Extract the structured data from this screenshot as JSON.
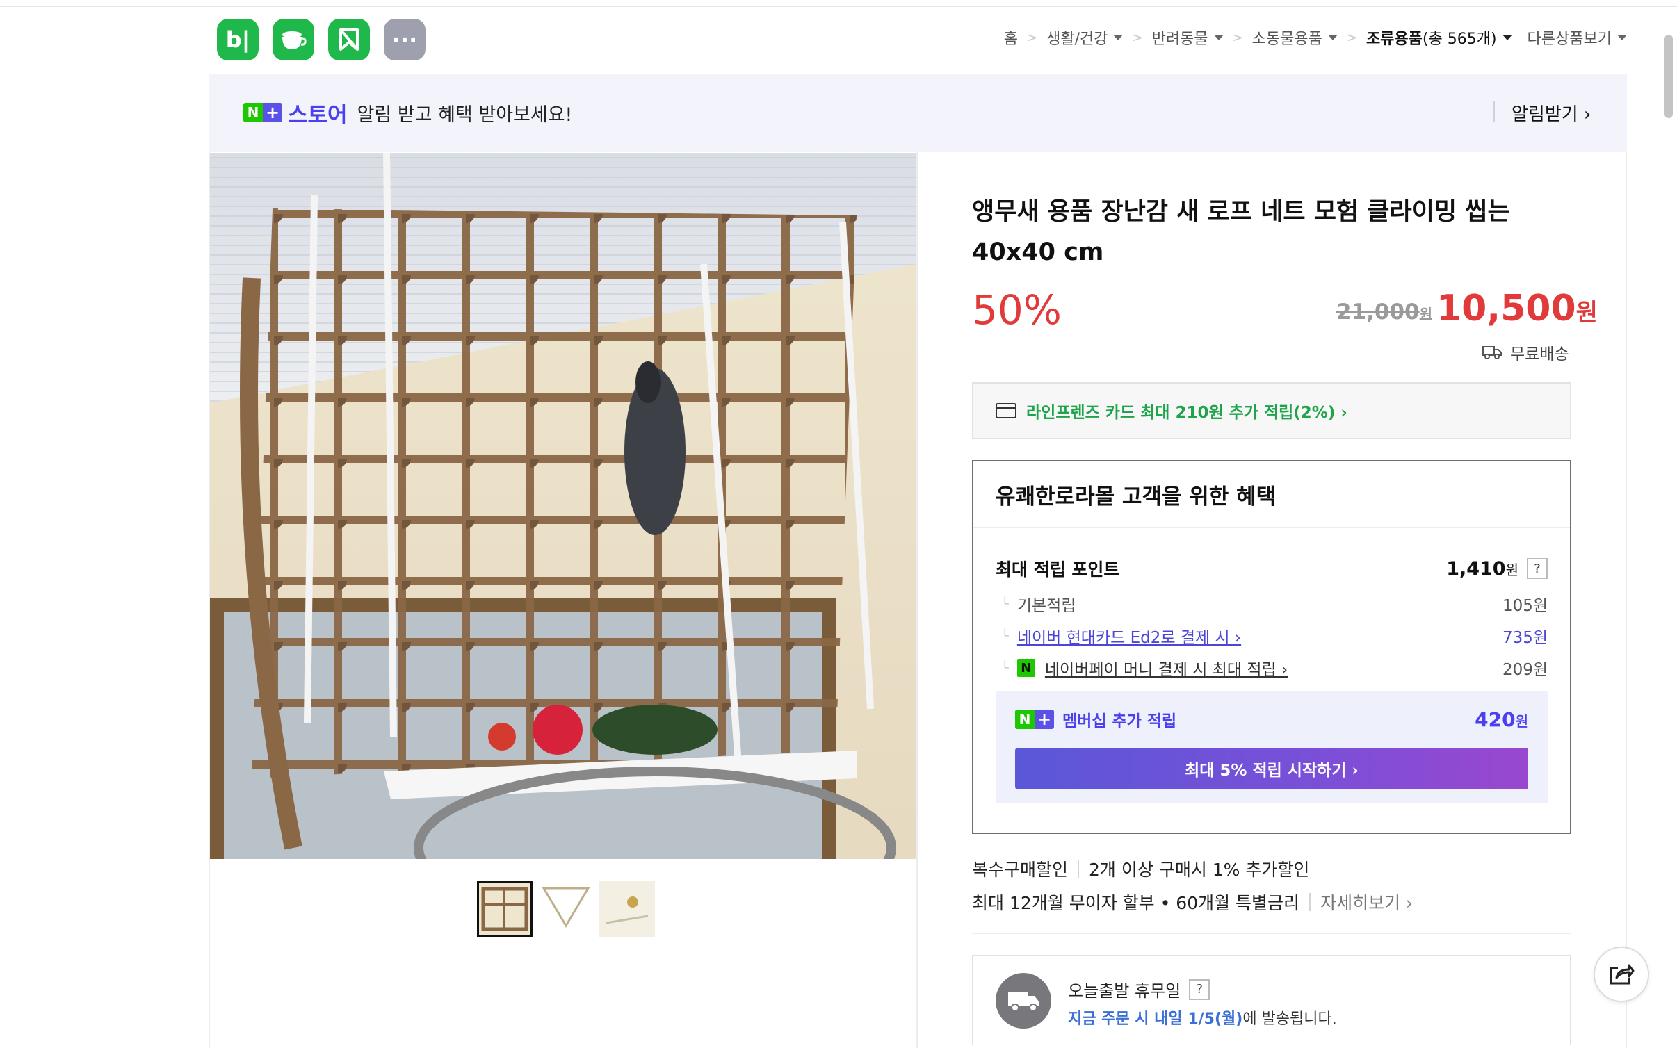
{
  "app_icons": [
    {
      "name": "blog",
      "glyph": "b|"
    },
    {
      "name": "cafe",
      "glyph": "☕"
    },
    {
      "name": "kin",
      "glyph": "K"
    },
    {
      "name": "more",
      "glyph": "···"
    }
  ],
  "breadcrumb": {
    "home": "홈",
    "items": [
      "생활/건강",
      "반려동물",
      "소동물용품"
    ],
    "current": "조류용품",
    "current_count": "(총 565개)",
    "other": "다른상품보기"
  },
  "banner": {
    "badge_n": "N",
    "badge_plus": "+",
    "store": "스토어",
    "message": "알림 받고 혜택 받아보세요!",
    "button": "알림받기 ›"
  },
  "product": {
    "title": "앵무새 용품 장난감 새 로프 네트 모험 클라이밍 씹는 40x40 cm",
    "discount": "50%",
    "original_price": "21,000",
    "original_unit": "원",
    "sale_price": "10,500",
    "sale_unit": "원",
    "shipping": "무료배송"
  },
  "card_promo": "라인프렌즈 카드 최대 210원 추가 적립(2%) ›",
  "benefit": {
    "heading": "유쾌한로라몰 고객을 위한 혜택",
    "max_label": "최대 적립 포인트",
    "max_value": "1,410",
    "max_unit": "원",
    "question": "?",
    "rows": [
      {
        "label": "기본적립",
        "value": "105원"
      },
      {
        "label": "네이버 현대카드 Ed2로 결제 시 ›",
        "value": "735원"
      },
      {
        "label": "네이버페이 머니 결제 시 최대 적립 ›",
        "value": "209원"
      }
    ],
    "npay_badge": "N",
    "membership_label": "멤버십 추가 적립",
    "membership_value": "420",
    "membership_unit": "원",
    "membership_button": "최대 5% 적립 시작하기 ›"
  },
  "multi_discount": {
    "label": "복수구매할인",
    "text": "2개 이상 구매시 1% 추가할인"
  },
  "installment": {
    "text": "최대 12개월 무이자 할부 • 60개월 특별금리",
    "more": "자세히보기 ›"
  },
  "shipping_info": {
    "title": "오늘출발 휴무일",
    "question": "?",
    "highlight": "지금 주문 시 내일 1/5(월)",
    "suffix": "에 발송됩니다."
  },
  "colors": {
    "accent_red": "#e03a3a",
    "naver_green": "#1ec800",
    "store_purple": "#4b3ff0"
  }
}
